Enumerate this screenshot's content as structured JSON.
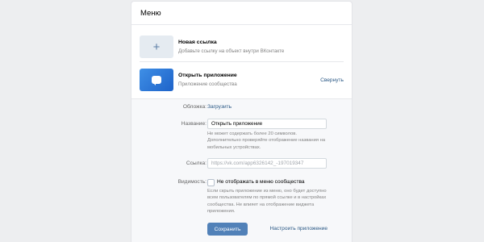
{
  "header": {
    "title": "Меню"
  },
  "items": [
    {
      "title": "Новая ссылка",
      "subtitle": "Добавьте ссылку на объект внутри ВКонтакте",
      "icon": "plus-icon"
    },
    {
      "title": "Открыть приложение",
      "subtitle": "Приложение сообщества",
      "icon": "message-bubble-icon",
      "action": "Свернуть"
    }
  ],
  "form": {
    "cover_label": "Обложка:",
    "cover_action": "Загрузить",
    "name_label": "Название:",
    "name_value": "Открыть приложение",
    "name_hint": "Не может содержать более 20 символов. Дополнительно проверяйте отображение названия на мобильных устройствах.",
    "link_label": "Ссылка:",
    "link_placeholder": "https://vk.com/app6326142_-197019347",
    "visibility_label": "Видимость:",
    "visibility_checkbox_label": "Не отображать в меню сообщества",
    "visibility_hint": "Если скрыть приложение из меню, оно будет доступно всем пользователям по прямой ссылке и в настройках сообщества. Не влияет на отображение виджета приложения.",
    "save_label": "Сохранить",
    "app_settings_label": "Настроить приложение"
  },
  "colors": {
    "accent": "#5181b8",
    "link": "#2a5885",
    "background": "#edeef0"
  }
}
